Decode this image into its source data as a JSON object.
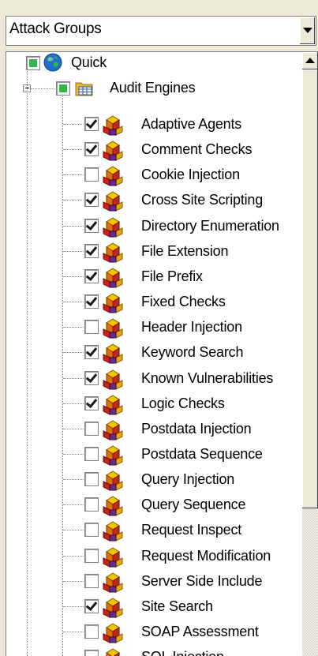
{
  "combo": {
    "value": "Attack Groups",
    "icon": "chevron-down-icon"
  },
  "tree": {
    "root": {
      "label": "Quick",
      "icon": "globe-icon",
      "check_state": "partial"
    },
    "group": {
      "label": "Audit Engines",
      "icon": "folder-grid-icon",
      "check_state": "partial"
    },
    "items": [
      {
        "label": "Adaptive Agents",
        "checked": true
      },
      {
        "label": "Comment Checks",
        "checked": true
      },
      {
        "label": "Cookie Injection",
        "checked": false
      },
      {
        "label": "Cross Site Scripting",
        "checked": true
      },
      {
        "label": "Directory Enumeration",
        "checked": true
      },
      {
        "label": "File Extension",
        "checked": true
      },
      {
        "label": "File Prefix",
        "checked": true
      },
      {
        "label": "Fixed Checks",
        "checked": true
      },
      {
        "label": "Header Injection",
        "checked": false
      },
      {
        "label": "Keyword Search",
        "checked": true
      },
      {
        "label": "Known Vulnerabilities",
        "checked": true
      },
      {
        "label": "Logic Checks",
        "checked": true
      },
      {
        "label": "Postdata Injection",
        "checked": false
      },
      {
        "label": "Postdata Sequence",
        "checked": false
      },
      {
        "label": "Query Injection",
        "checked": false
      },
      {
        "label": "Query Sequence",
        "checked": false
      },
      {
        "label": "Request Inspect",
        "checked": false
      },
      {
        "label": "Request Modification",
        "checked": false
      },
      {
        "label": "Server Side Include",
        "checked": false
      },
      {
        "label": "Site Search",
        "checked": true
      },
      {
        "label": "SOAP Assessment",
        "checked": false
      },
      {
        "label": "SQL Injection",
        "checked": false
      }
    ],
    "item_icon": "audit-engine-icon"
  },
  "colors": {
    "partial_check": "#2eb84a",
    "globe": "#1e6fd0",
    "folder": "#e8b830"
  }
}
